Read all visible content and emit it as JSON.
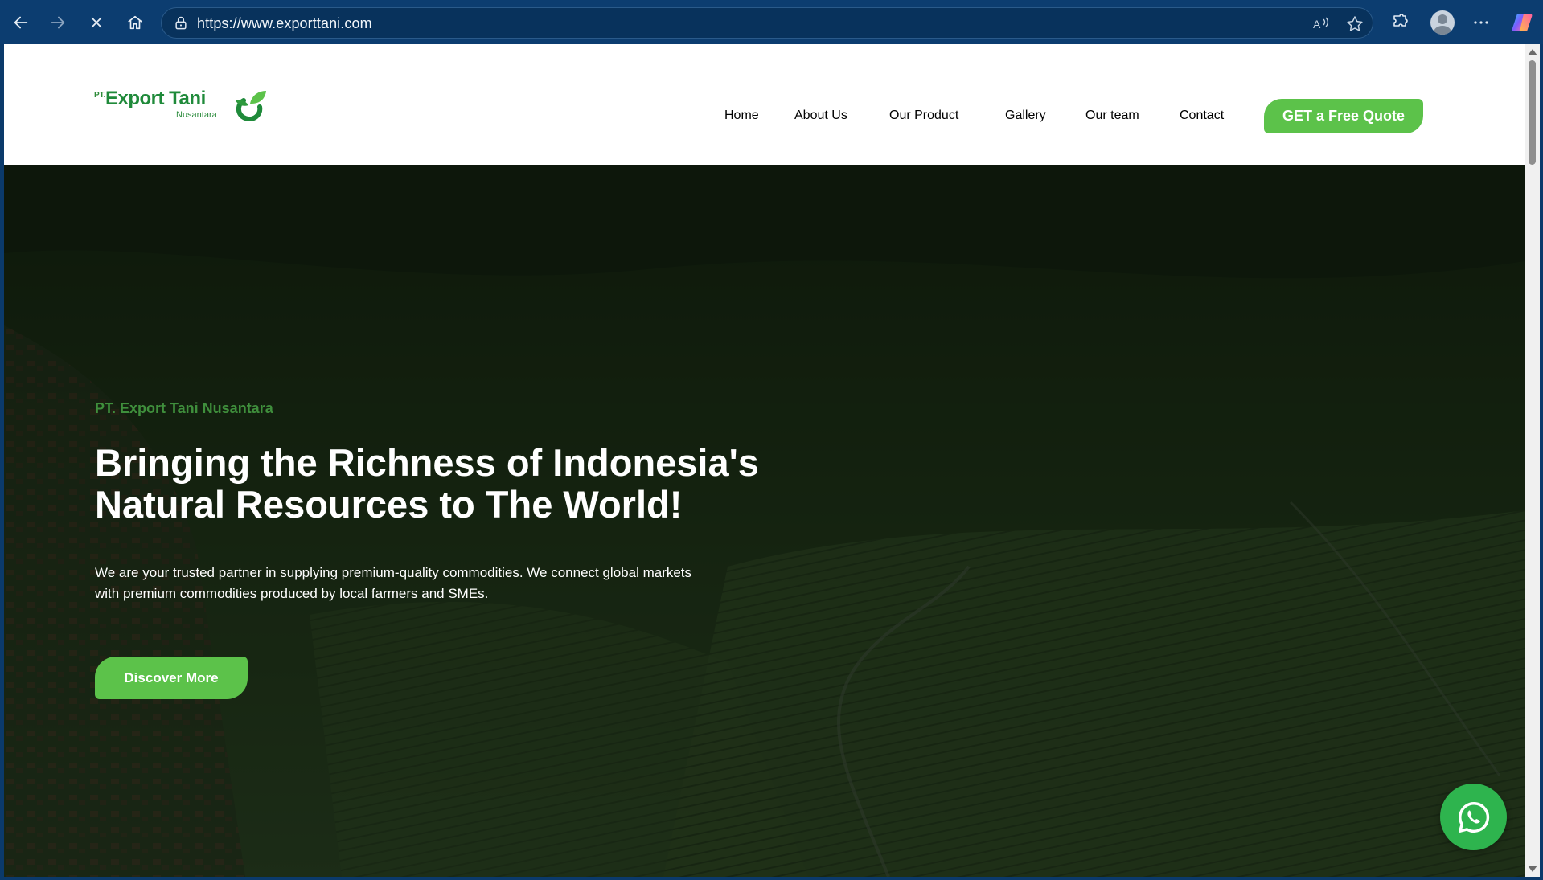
{
  "browser": {
    "url": "https://www.exporttani.com"
  },
  "site": {
    "logo": {
      "prefix": "PT.",
      "name": "Export Tani",
      "subname": "Nusantara"
    },
    "nav": [
      {
        "label": "Home"
      },
      {
        "label": "About Us"
      },
      {
        "label": "Our Product"
      },
      {
        "label": "Gallery"
      },
      {
        "label": "Our team"
      },
      {
        "label": "Contact"
      }
    ],
    "quote_button": "GET a Free Quote",
    "hero": {
      "kicker": "PT. Export Tani Nusantara",
      "headline_line1": "Bringing the Richness of Indonesia's",
      "headline_line2": "Natural Resources to The World!",
      "description_line1": "We are your trusted partner in supplying premium-quality commodities. We connect global markets",
      "description_line2": "with premium commodities produced by local farmers and SMEs.",
      "cta": "Discover More"
    }
  },
  "colors": {
    "brand_green": "#5cc24a",
    "nav_text": "#2a6a2e",
    "chrome_bg": "#0c3d70",
    "whatsapp": "#2eb44e"
  }
}
